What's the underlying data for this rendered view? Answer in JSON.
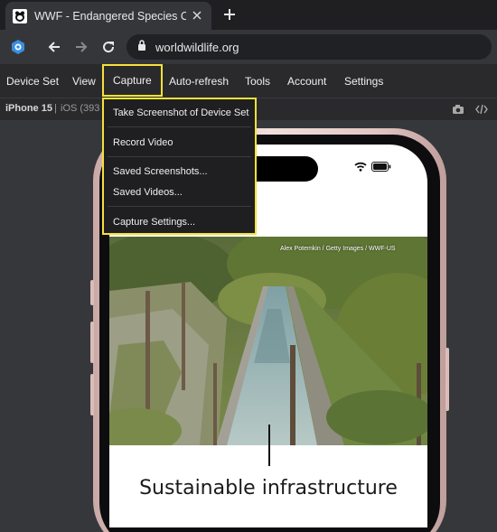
{
  "browser": {
    "tab_title": "WWF - Endangered Species Cons",
    "url": "worldwildlife.org",
    "icons": [
      "wwf-panda-favicon",
      "close-icon",
      "plus-icon",
      "extension-icon",
      "back-arrow-icon",
      "forward-arrow-icon",
      "reload-icon",
      "lock-icon"
    ]
  },
  "menubar": {
    "items": [
      "Device Set",
      "View",
      "Capture",
      "Auto-refresh",
      "Tools",
      "Account",
      "Settings"
    ],
    "active": "Capture",
    "accent": "#f4e13a"
  },
  "device_bar": {
    "name": "iPhone 15",
    "separator": "|",
    "os_fragment": "iOS (393",
    "icons": [
      "camera-icon",
      "code-icon"
    ]
  },
  "capture_menu": {
    "items": [
      "Take Screenshot of Device Set",
      "Record Video",
      "Saved Screenshots...",
      "Saved Videos...",
      "Capture Settings..."
    ]
  },
  "phone": {
    "photo_credit": "Alex Potemkin / Getty Images / WWF-US",
    "heading": "Sustainable infrastructure"
  }
}
